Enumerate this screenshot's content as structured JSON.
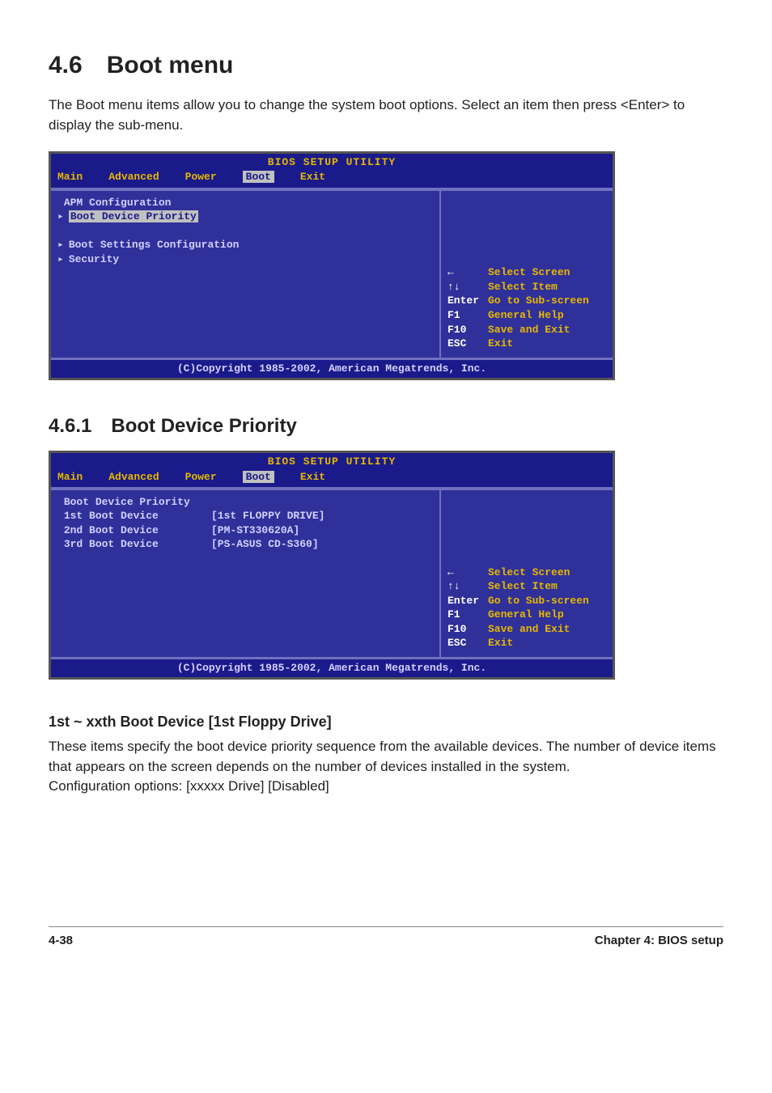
{
  "section": {
    "num": "4.6",
    "title": "Boot menu"
  },
  "intro": "The Boot menu items allow you to change the system boot options. Select an item then press <Enter> to display the sub-menu.",
  "bios_common": {
    "title": "BIOS SETUP UTILITY",
    "tabs": {
      "main": "Main",
      "advanced": "Advanced",
      "power": "Power",
      "boot": "Boot",
      "exit": "Exit"
    },
    "footer": "(C)Copyright 1985-2002, American Megatrends, Inc.",
    "hints": {
      "lr": {
        "key": "←",
        "desc": "Select Screen"
      },
      "ud": {
        "key": "↑↓",
        "desc": "Select Item"
      },
      "enter": {
        "key": "Enter",
        "desc": "Go to Sub-screen"
      },
      "f1": {
        "key": "F1",
        "desc": "General Help"
      },
      "f10": {
        "key": "F10",
        "desc": "Save and Exit"
      },
      "esc": {
        "key": "ESC",
        "desc": "Exit"
      }
    }
  },
  "bios1": {
    "header": "APM Configuration",
    "items": {
      "i1": "Boot Device Priority",
      "i2": "Boot Settings Configuration",
      "i3": "Security"
    }
  },
  "sub461": {
    "num": "4.6.1",
    "title": "Boot Device Priority"
  },
  "bios2": {
    "header": "Boot Device Priority",
    "rows": {
      "r1": {
        "label": "1st Boot Device",
        "value": "[1st FLOPPY DRIVE]"
      },
      "r2": {
        "label": "2nd Boot Device",
        "value": "[PM-ST330620A]"
      },
      "r3": {
        "label": "3rd Boot Device",
        "value": "[PS-ASUS CD-S360]"
      }
    }
  },
  "item_head": "1st ~ xxth Boot Device [1st Floppy Drive]",
  "body1": "These items specify the boot device priority sequence from the available devices. The number of device items that appears on the screen depends on the number of devices installed in the system.",
  "body2": "Configuration options: [xxxxx Drive] [Disabled]",
  "footer": {
    "page": "4-38",
    "chapter": "Chapter 4: BIOS setup"
  }
}
